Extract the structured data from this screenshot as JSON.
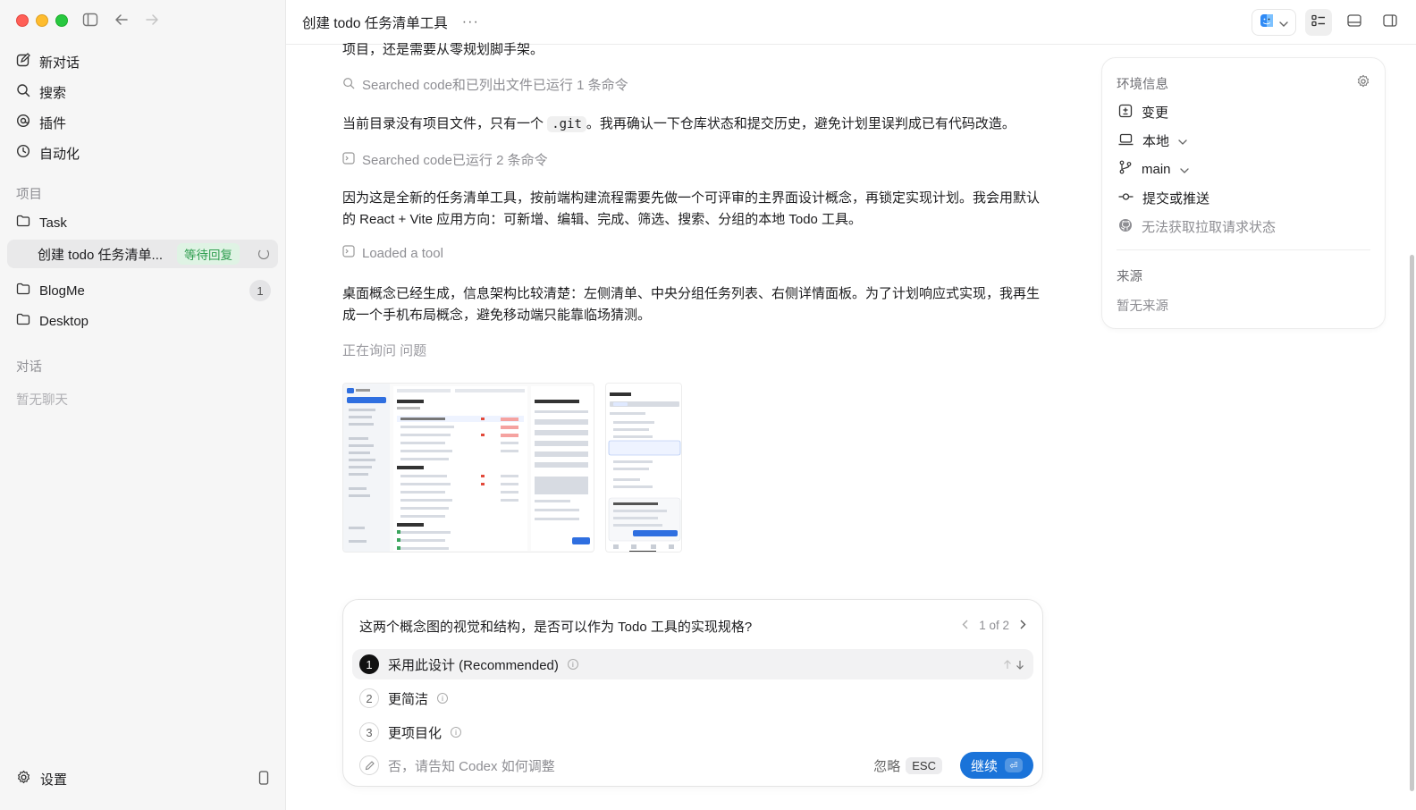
{
  "sidebar": {
    "nav": [
      {
        "label": "新对话",
        "icon": "compose-icon"
      },
      {
        "label": "搜索",
        "icon": "search-icon"
      },
      {
        "label": "插件",
        "icon": "plugin-icon"
      },
      {
        "label": "自动化",
        "icon": "clock-icon"
      }
    ],
    "projects_label": "项目",
    "projects": [
      {
        "label": "Task"
      },
      {
        "label": "创建 todo 任务清单...",
        "badge": "等待回复"
      },
      {
        "label": "BlogMe",
        "count": "1"
      },
      {
        "label": "Desktop"
      }
    ],
    "chats_label": "对话",
    "chats_empty": "暂无聊天",
    "settings_label": "设置"
  },
  "header": {
    "title": "创建 todo 任务清单工具",
    "more": "···"
  },
  "messages": {
    "top_fragment": "项目，还是需要从零规划脚手架。",
    "meta1": "Searched code和已列出文件已运行 1 条命令",
    "p1_before": "当前目录没有项目文件，只有一个",
    "p1_code": ".git",
    "p1_after": "。我再确认一下仓库状态和提交历史，避免计划里误判成已有代码改造。",
    "meta2": "Searched code已运行 2 条命令",
    "p2": "因为这是全新的任务清单工具，按前端构建流程需要先做一个可评审的主界面设计概念，再锁定实现计划。我会用默认的 React + Vite 应用方向：可新增、编辑、完成、筛选、搜索、分组的本地 Todo 工具。",
    "meta3": "Loaded a tool",
    "p3": "桌面概念已经生成，信息架构比较清楚：左侧清单、中央分组任务列表、右侧详情面板。为了计划响应式实现，我再生成一个手机布局概念，避免移动端只能靠临场猜测。",
    "asking": "正在询问 问题"
  },
  "panel": {
    "title": "环境信息",
    "rows": [
      {
        "label": "变更",
        "icon": "diff-icon"
      },
      {
        "label": "本地",
        "icon": "laptop-icon"
      },
      {
        "label": "main",
        "icon": "branch-icon"
      },
      {
        "label": "提交或推送",
        "icon": "commit-icon"
      },
      {
        "label": "无法获取拉取请求状态",
        "icon": "github-icon"
      }
    ],
    "source_label": "来源",
    "source_empty": "暂无来源"
  },
  "question": {
    "title": "这两个概念图的视觉和结构，是否可以作为 Todo 工具的实现规格?",
    "pager": "1 of 2",
    "options": [
      {
        "num": "1",
        "label": "采用此设计 (Recommended)"
      },
      {
        "num": "2",
        "label": "更简洁"
      },
      {
        "num": "3",
        "label": "更项目化"
      }
    ],
    "input_placeholder": "否，请告知 Codex 如何调整",
    "ignore_label": "忽略",
    "esc_label": "ESC",
    "continue_label": "继续"
  },
  "colors": {
    "accent": "#1a73d9",
    "badge_green": "#2f9e4f",
    "sidebar_bg": "#f6f6f6"
  }
}
